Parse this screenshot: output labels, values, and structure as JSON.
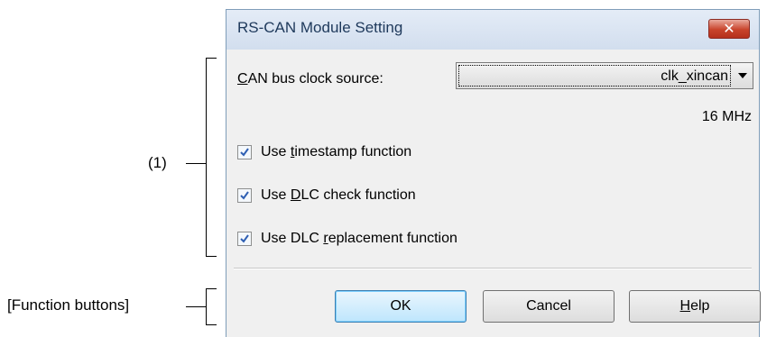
{
  "callouts": {
    "section1": "(1)",
    "function_buttons": "[Function buttons]"
  },
  "dialog": {
    "title": "RS-CAN Module Setting",
    "close_icon": "close-x-icon",
    "clock_source": {
      "label_mnemonic": "C",
      "label_rest": "AN bus clock source:",
      "selected_value": "clk_xincan",
      "frequency": "16 MHz"
    },
    "options": [
      {
        "pre": "Use ",
        "mnemonic": "t",
        "post": "imestamp function",
        "checked": true
      },
      {
        "pre": "Use ",
        "mnemonic": "D",
        "post": "LC check function",
        "checked": true
      },
      {
        "pre": "Use DLC ",
        "mnemonic": "r",
        "post": "eplacement function",
        "checked": true
      }
    ],
    "buttons": {
      "ok": "OK",
      "cancel": "Cancel",
      "help_mnemonic": "H",
      "help_rest": "elp"
    }
  },
  "colors": {
    "close_button": "#c8432b",
    "checkmark": "#2e5fb3",
    "title_text": "#1e395b"
  }
}
